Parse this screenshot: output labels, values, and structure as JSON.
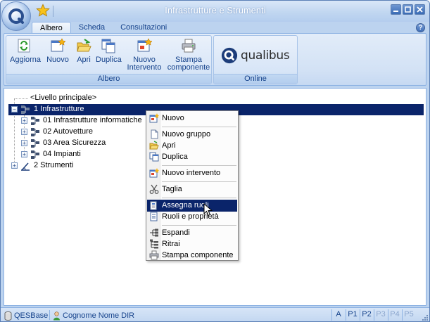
{
  "window": {
    "title": "Infrastrutture e Strumenti"
  },
  "tabs": [
    {
      "label": "Albero",
      "active": true
    },
    {
      "label": "Scheda",
      "active": false
    },
    {
      "label": "Consultazioni",
      "active": false
    }
  ],
  "ribbon": {
    "albero_group": {
      "label": "Albero",
      "buttons": [
        {
          "label": "Aggiorna",
          "icon": "refresh-icon"
        },
        {
          "label": "Nuovo",
          "icon": "new-icon"
        },
        {
          "label": "Apri",
          "icon": "folder-open-icon"
        },
        {
          "label": "Duplica",
          "icon": "duplicate-icon"
        },
        {
          "label1": "Nuovo",
          "label2": "Intervento",
          "icon": "new-intervention-icon"
        },
        {
          "label1": "Stampa",
          "label2": "componente",
          "icon": "printer-icon"
        }
      ]
    },
    "online_group": {
      "label": "Online",
      "logo_text": "qualibus"
    }
  },
  "tree": {
    "root": "<Livello principale>",
    "items": [
      {
        "label": "1 Infrastrutture",
        "selected": true
      },
      {
        "label": "01 Infrastrutture informatiche"
      },
      {
        "label": "02 Autovetture"
      },
      {
        "label": "03 Area Sicurezza"
      },
      {
        "label": "04 Impianti"
      },
      {
        "label": "2 Strumenti"
      }
    ]
  },
  "context_menu": {
    "items": [
      {
        "label": "Nuovo",
        "icon": "new-icon"
      },
      {
        "label": "Nuovo gruppo",
        "icon": "document-icon"
      },
      {
        "label": "Apri",
        "icon": "folder-open-icon"
      },
      {
        "label": "Duplica",
        "icon": "duplicate-icon"
      },
      {
        "label": "Nuovo intervento",
        "icon": "new-intervention-icon"
      },
      {
        "label": "Taglia",
        "icon": "scissors-icon"
      },
      {
        "label": "Assegna ruoli",
        "icon": "assign-roles-icon",
        "highlighted": true
      },
      {
        "label": "Ruoli e proprietà",
        "icon": "roles-properties-icon"
      },
      {
        "label": "Espandi",
        "icon": "expand-icon"
      },
      {
        "label": "Ritrai",
        "icon": "collapse-icon"
      },
      {
        "label": "Stampa componente",
        "icon": "printer-icon"
      }
    ]
  },
  "status": {
    "db": "QESBase",
    "user": "Cognome Nome DIR",
    "keys": [
      {
        "label": "A",
        "enabled": true
      },
      {
        "label": "P1",
        "enabled": true
      },
      {
        "label": "P2",
        "enabled": true
      },
      {
        "label": "P3",
        "enabled": false
      },
      {
        "label": "P4",
        "enabled": false
      },
      {
        "label": "P5",
        "enabled": false
      }
    ]
  },
  "colors": {
    "selection": "#0a246a",
    "ribbon_text": "#15428b",
    "frame": "#bcd3ef"
  }
}
